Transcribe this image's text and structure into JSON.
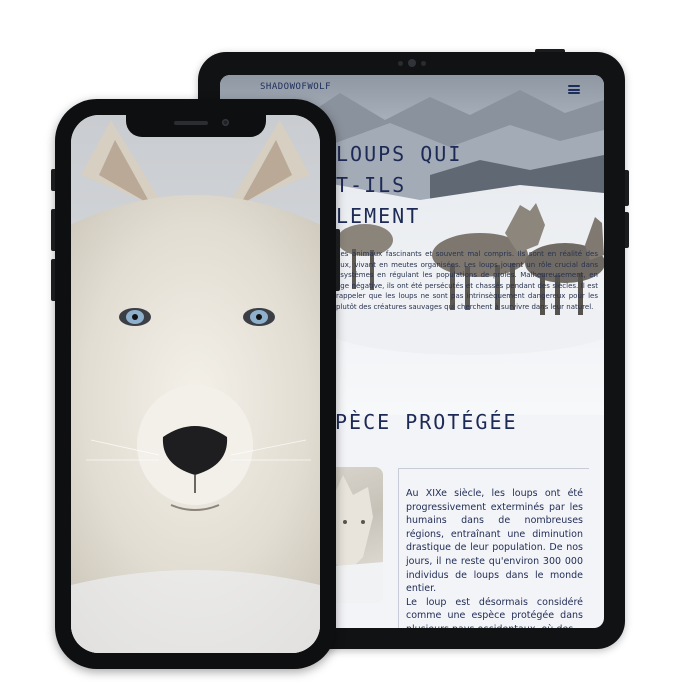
{
  "tablet": {
    "logo": "SHADOWOFWOLF",
    "hero": {
      "title_lines": [
        "LOUPS QUI",
        "T-ILS",
        "LEMENT"
      ],
      "paragraph": "des animaux fascinants et souvent mal compris. Ils sont en réalité des aux, vivant en meutes organisées. Les loups jouent un rôle crucial dans osystèmes en régulant les populations de proies. Malheureusement, en age négative, ils ont été persécutés et chassés pendant des siècles. Il est rappeler que les loups ne sont pas intrinsèquement dangereux pour les plutôt des créatures sauvages qui cherchent à survivre dans leur naturel."
    },
    "section": {
      "title": "PÈCE PROTÉGÉE",
      "paragraph_1": "Au XIXe siècle, les loups ont été progressivement exterminés par les humains dans de nombreuses régions, entraînant une diminution drastique de leur population. De nos jours, il ne reste qu'environ 300 000 individus de loups dans le monde entier.",
      "paragraph_2": "Le loup est désormais considéré comme une espèce protégée dans plusieurs pays occidentaux, où des"
    }
  },
  "colors": {
    "navy_text": "#1d2a55",
    "device_frame": "#111214",
    "page_background": "#ffffff"
  },
  "icons": {
    "menu": "hamburger-menu-icon"
  }
}
